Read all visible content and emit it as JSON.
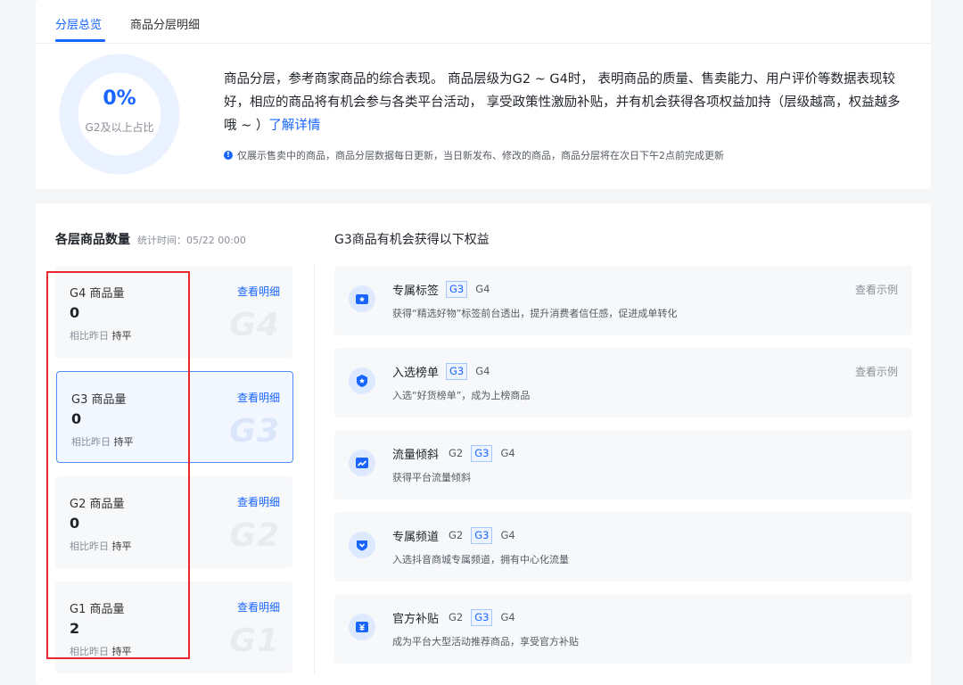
{
  "tabs": [
    {
      "label": "分层总览",
      "active": true
    },
    {
      "label": "商品分层明细",
      "active": false
    }
  ],
  "overview": {
    "ring_value": "0%",
    "ring_caption": "G2及以上占比",
    "ring_fraction": 0,
    "intro_text": "商品分层，参考商家商品的综合表现。 商品层级为G2 ~ G4时， 表明商品的质量、售卖能力、用户评价等数据表现较好，相应的商品将有机会参与各类平台活动， 享受政策性激励补贴，并有机会获得各项权益加持（层级越高，权益越多哦 ~ ）",
    "learn_more": "了解详情",
    "note_icon": "info-icon",
    "note_text": "仅展示售卖中的商品，商品分层数据每日更新，当日新发布、修改的商品，商品分层将在次日下午2点前完成更新"
  },
  "counts": {
    "title": "各层商品数量",
    "stat_time": "统计时间：05/22 00:00",
    "cards": [
      {
        "name": "G4 商品量",
        "link": "查看明细",
        "count": "0",
        "cmp_label": "相比昨日",
        "cmp_value": "持平",
        "watermark": "G4",
        "active": false
      },
      {
        "name": "G3 商品量",
        "link": "查看明细",
        "count": "0",
        "cmp_label": "相比昨日",
        "cmp_value": "持平",
        "watermark": "G3",
        "active": true
      },
      {
        "name": "G2 商品量",
        "link": "查看明细",
        "count": "0",
        "cmp_label": "相比昨日",
        "cmp_value": "持平",
        "watermark": "G2",
        "active": false
      },
      {
        "name": "G1 商品量",
        "link": "查看明细",
        "count": "2",
        "cmp_label": "相比昨日",
        "cmp_value": "持平",
        "watermark": "G1",
        "active": false
      }
    ]
  },
  "benefits": {
    "title": "G3商品有机会获得以下权益",
    "items": [
      {
        "title": "专属标签",
        "tiers": [
          "G3",
          "G4"
        ],
        "desc": "获得“精选好物”标签前台透出，提升消费者信任感，促进成单转化",
        "link": "查看示例",
        "icon": "tag-icon"
      },
      {
        "title": "入选榜单",
        "tiers": [
          "G3",
          "G4"
        ],
        "desc": "入选“好货榜单”，成为上榜商品",
        "link": "查看示例",
        "icon": "ranking-icon"
      },
      {
        "title": "流量倾斜",
        "tiers": [
          "G2",
          "G3",
          "G4"
        ],
        "desc": "获得平台流量倾斜",
        "link": "",
        "icon": "trend-icon"
      },
      {
        "title": "专属频道",
        "tiers": [
          "G2",
          "G3",
          "G4"
        ],
        "desc": "入选抖音商城专属频道，拥有中心化流量",
        "link": "",
        "icon": "channel-icon"
      },
      {
        "title": "官方补贴",
        "tiers": [
          "G2",
          "G3",
          "G4"
        ],
        "desc": "成为平台大型活动推荐商品，享受官方补贴",
        "link": "",
        "icon": "subsidy-icon"
      }
    ],
    "highlight_tier": "G3"
  },
  "colors": {
    "accent": "#1966ff",
    "highlight_box": "#e8282e"
  }
}
